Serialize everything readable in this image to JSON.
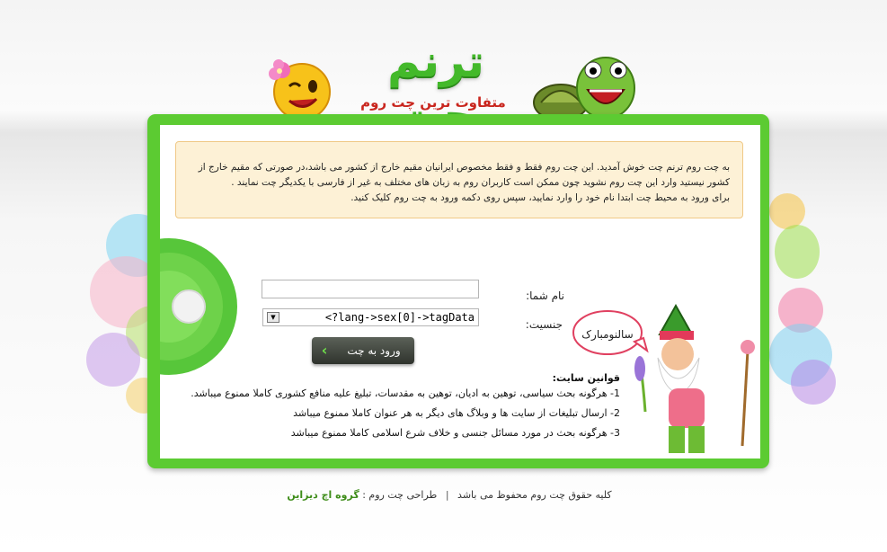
{
  "brand": {
    "title": "ترنم چت",
    "subtitle": "متفاوت ترین چت روم ایرانیان"
  },
  "notice": {
    "line1": "به چت روم ترنم چت خوش آمدید. این چت روم فقط و فقط مخصوص ایرانیان مقیم خارج از کشور می باشد،در صورتی که مقیم خارج از",
    "line2": "کشور نیستید وارد این چت روم نشوید چون ممکن است کاربران روم به زبان های مختلف به غیر از فارسی با یکدیگر چت نمایند .",
    "line3": "برای ورود به محیط چت ابتدا نام خود را وارد نمایید، سپس روی دکمه ورود به چت روم کلیک کنید."
  },
  "form": {
    "name_label": "نام شما:",
    "name_value": "",
    "gender_label": "جنسیت:",
    "gender_value": "<?lang->sex[0]->tagData",
    "enter_label": "ورود به چت"
  },
  "rules": {
    "title": "قوانین سایت:",
    "items": [
      "1- هرگونه بحث سیاسی، توهین به ادیان، توهین به مقدسات، تبلیغ علیه منافع کشوری کاملا ممنوع میباشد.",
      "2- ارسال تبلیغات از سایت ها و وبلاگ های دیگر به هر عنوان کاملا ممنوع میباشد",
      "3- هرگونه بحث در مورد مسائل جنسی و خلاف شرع اسلامی کاملا ممنوع میباشد"
    ]
  },
  "mascot": {
    "bubble_text": "سالنومبارک"
  },
  "footer": {
    "copyright": "کلیه حقوق چت روم محفوظ می باشد",
    "separator": "|",
    "designer_label": "طراحی چت روم :",
    "designer_name": "گروه اچ دیزاین"
  },
  "colors": {
    "brand_green": "#5ccb32",
    "title_red": "#c9261e",
    "notice_bg": "#fdf1d6"
  }
}
